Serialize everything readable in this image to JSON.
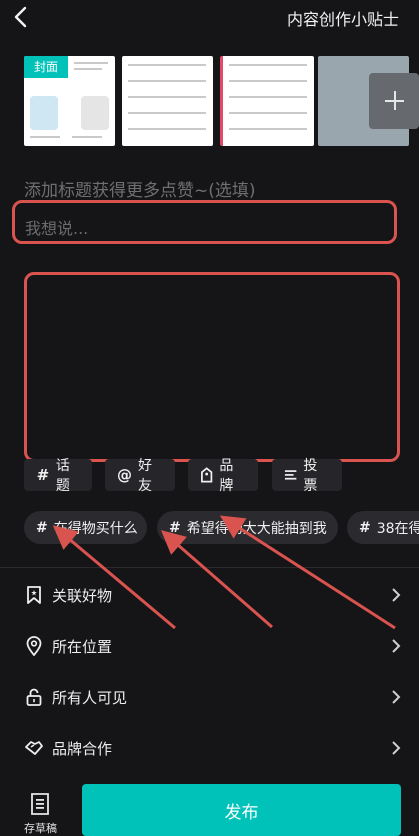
{
  "header": {
    "title": "内容创作小贴士"
  },
  "thumbnails": {
    "cover_badge": "封面"
  },
  "compose": {
    "title_placeholder": "添加标题获得更多点赞~(选填)",
    "say_placeholder": "我想说..."
  },
  "tools": [
    {
      "icon": "#",
      "label": "话题"
    },
    {
      "icon": "@",
      "label": "好友"
    },
    {
      "icon": "tag",
      "label": "品牌"
    },
    {
      "icon": "list",
      "label": "投票"
    }
  ],
  "chips": [
    {
      "label": "在得物买什么"
    },
    {
      "label": "希望得物大大能抽到我"
    },
    {
      "label": "38在得"
    }
  ],
  "menu": [
    {
      "label": "关联好物",
      "icon": "bookmark-icon"
    },
    {
      "label": "所在位置",
      "icon": "location-pin-icon"
    },
    {
      "label": "所有人可见",
      "icon": "lock-icon"
    },
    {
      "label": "品牌合作",
      "icon": "handshake-icon"
    }
  ],
  "footer": {
    "draft_label": "存草稿",
    "publish_label": "发布"
  },
  "colors": {
    "accent": "#00c2b8",
    "highlight": "#d9534f",
    "background": "#151518"
  }
}
